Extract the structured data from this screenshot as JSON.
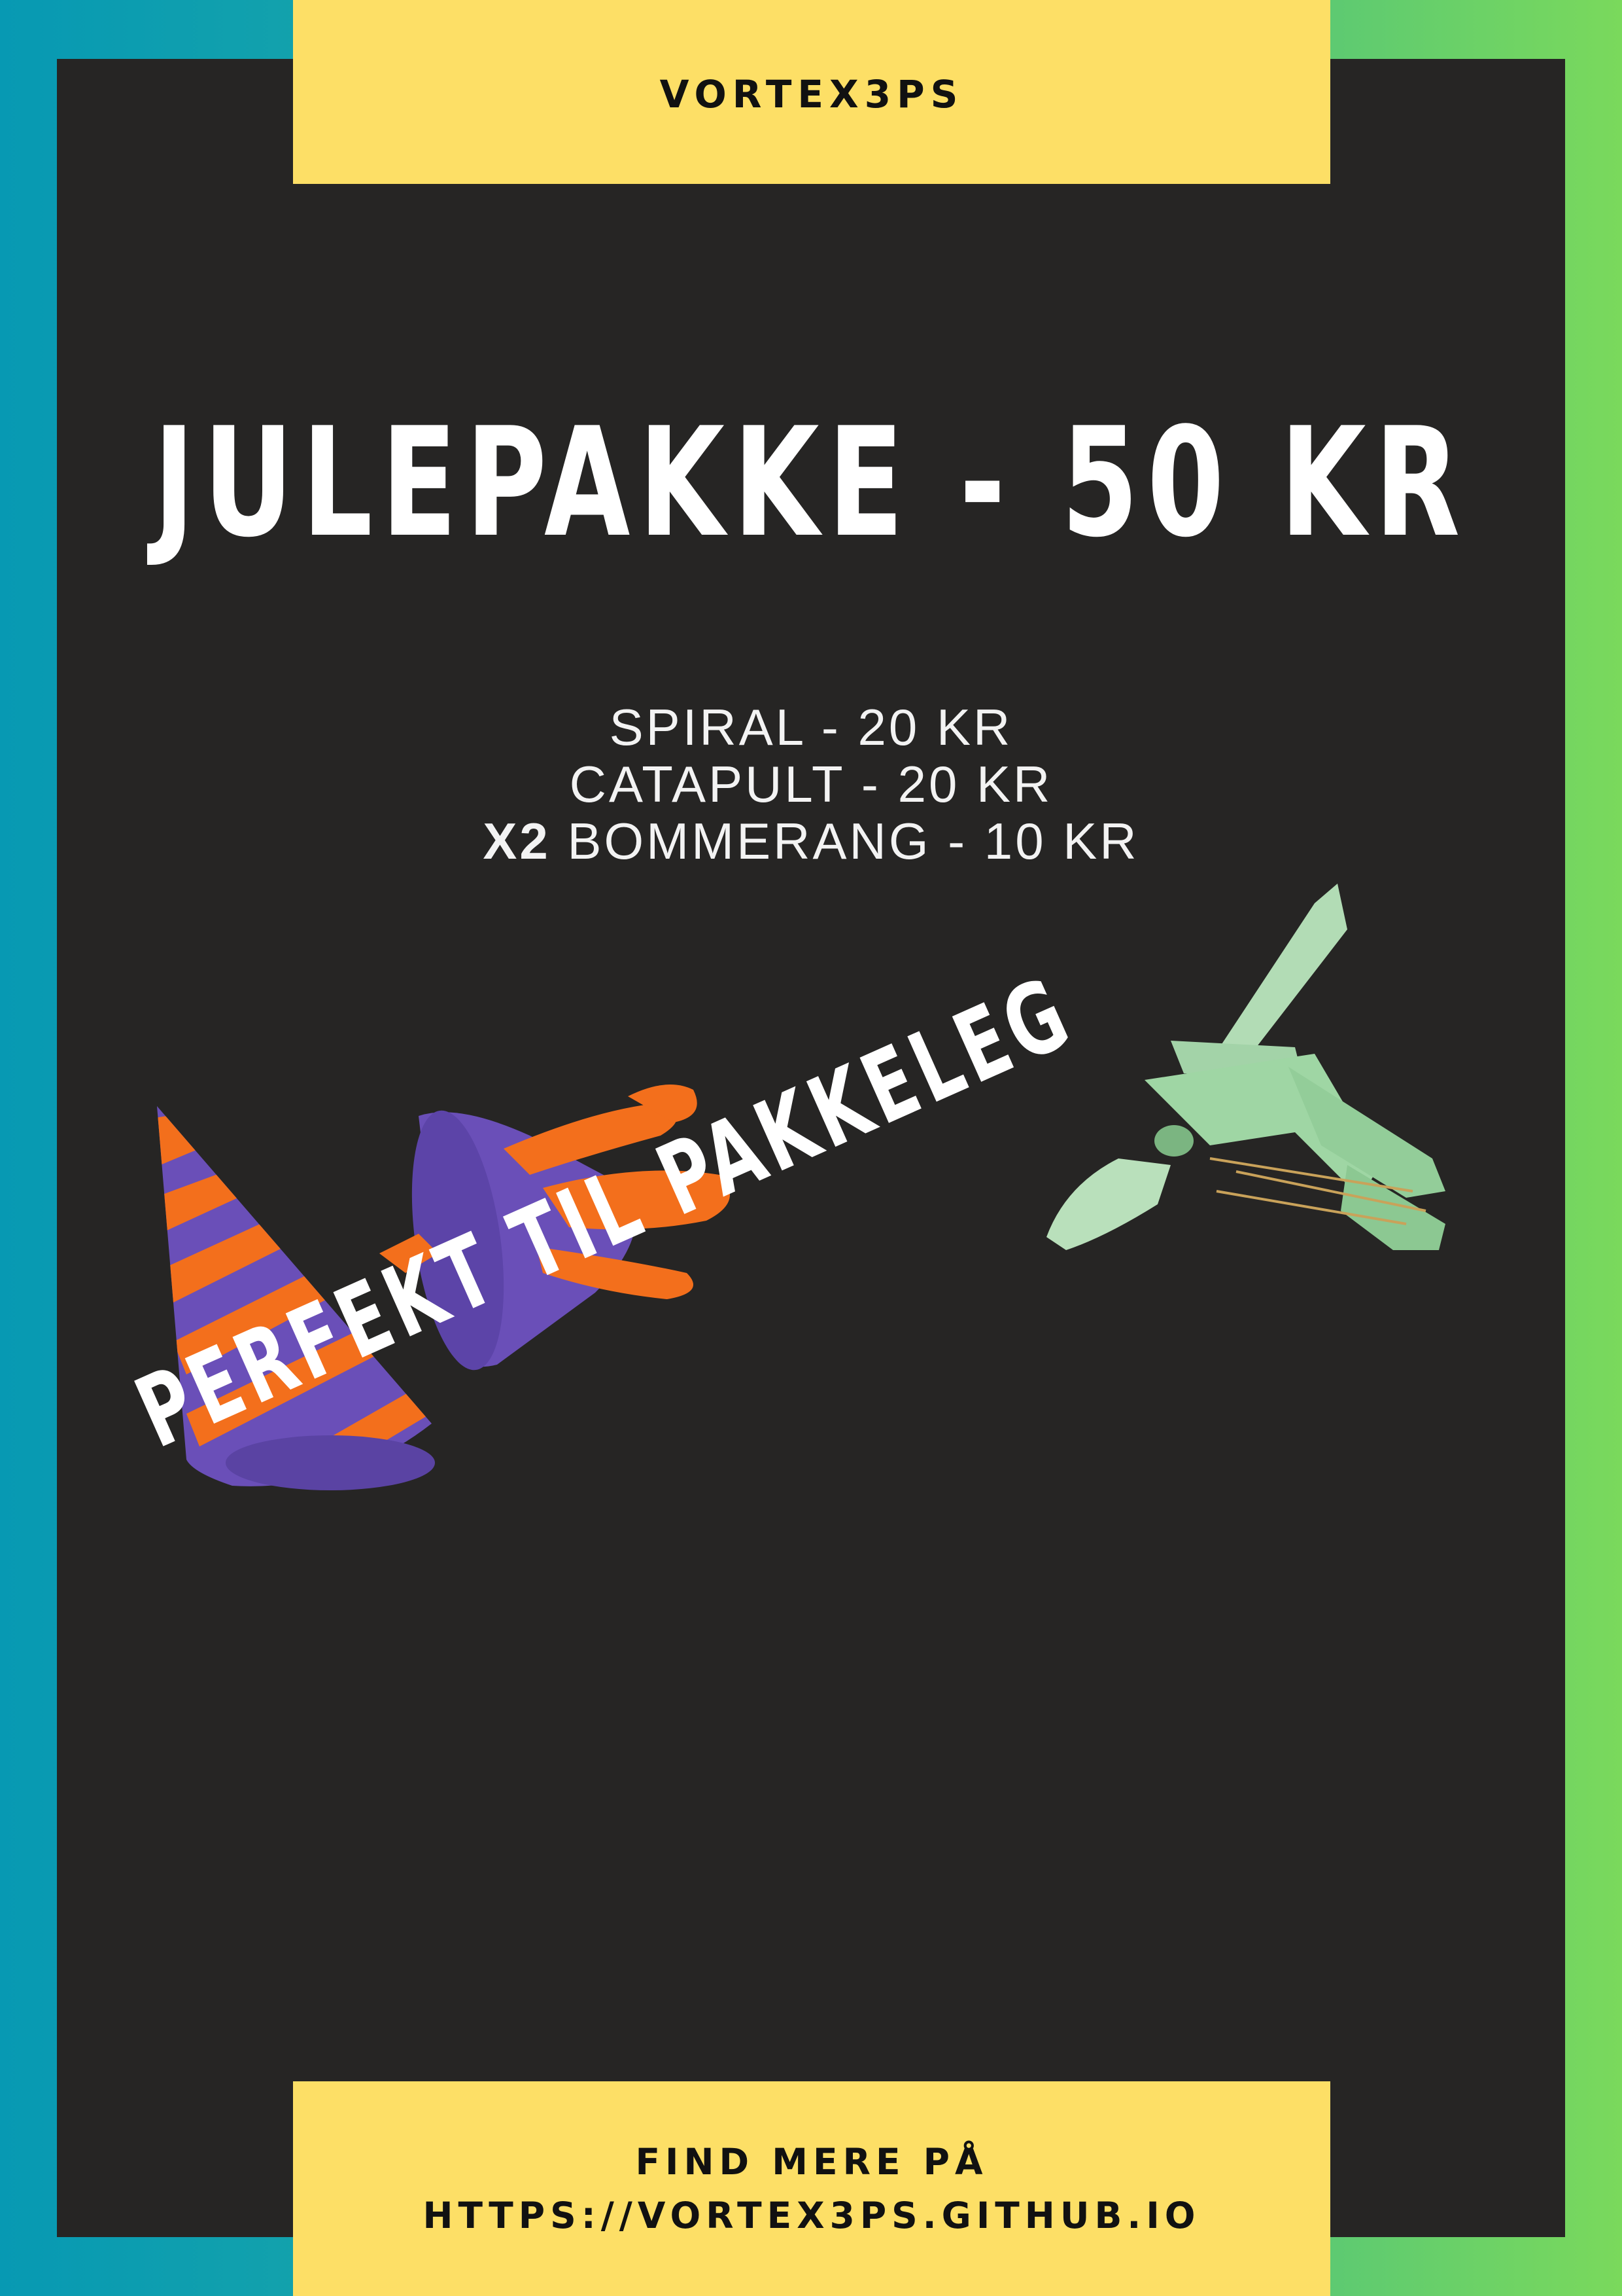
{
  "brand": {
    "name": "VORTEX3PS"
  },
  "headline": "JULEPAKKE - 50 KR",
  "items": [
    {
      "prefix": "",
      "label": "SPIRAL - 20 KR"
    },
    {
      "prefix": "",
      "label": "CATAPULT - 20 KR"
    },
    {
      "prefix": "X2",
      "label": "BOMMERANG - 10 KR"
    }
  ],
  "tagline": "PERFEKT TIL PAKKELEG",
  "footer": {
    "line1": "FIND MERE PÅ",
    "line2": "HTTPS://VORTEX3PS.GITHUB.IO"
  },
  "colors": {
    "background_left": "#0799b3",
    "background_right": "#7ad95c",
    "panel": "#262524",
    "banner": "#fddf66",
    "spiral_purple": "#6a4fb8",
    "spiral_orange": "#f36f1c",
    "catapult_green": "#9fd6a4"
  },
  "icons": [
    "spiral-cone-photo",
    "twisted-spiral-photo",
    "catapult-photo"
  ]
}
